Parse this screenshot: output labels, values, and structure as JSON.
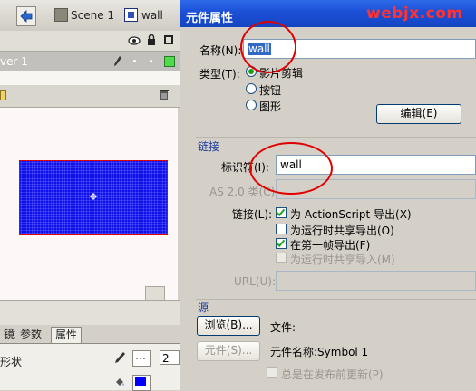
{
  "flash": {
    "scene_label": "Scene 1",
    "symbol_label": "wall",
    "layer_label": "ver 1",
    "tabs": [
      "镜",
      "参数",
      "属性"
    ],
    "shape_label": "形状",
    "stroke_height": "2",
    "fill_color": "#0000ff"
  },
  "dialog": {
    "title": "元件属性",
    "watermark": "webjx.com",
    "name_label": "名称(N):",
    "name_value": "wall",
    "type_label": "类型(T):",
    "types": [
      {
        "label": "影片剪辑",
        "selected": true
      },
      {
        "label": "按钮",
        "selected": false
      },
      {
        "label": "图形",
        "selected": false
      }
    ],
    "edit_button": "编辑(E)",
    "linkage_section": "链接",
    "identifier_label": "标识符(I):",
    "identifier_value": "wall",
    "as_class_label": "AS 2.0 类(C):",
    "linkage_label": "链接(L):",
    "linkage_options": [
      {
        "label": "为 ActionScript 导出(X)",
        "checked": true,
        "disabled": false
      },
      {
        "label": "为运行时共享导出(O)",
        "checked": false,
        "disabled": false
      },
      {
        "label": "在第一帧导出(F)",
        "checked": true,
        "disabled": false
      },
      {
        "label": "为运行时共享导入(M)",
        "checked": false,
        "disabled": true
      }
    ],
    "url_label": "URL(U):",
    "source_section": "源",
    "browse_button": "浏览(B)...",
    "file_label": "文件:",
    "symbol_button": "元件(S)...",
    "symbol_name_label": "元件名称:Symbol 1",
    "always_update_label": "总是在发布前更新(P)"
  },
  "colors": {
    "title_bar": "#1b4fd6",
    "annotation_circle": "#e00000",
    "watermark": "#ff3333",
    "wall_fill": "#1010e8"
  }
}
